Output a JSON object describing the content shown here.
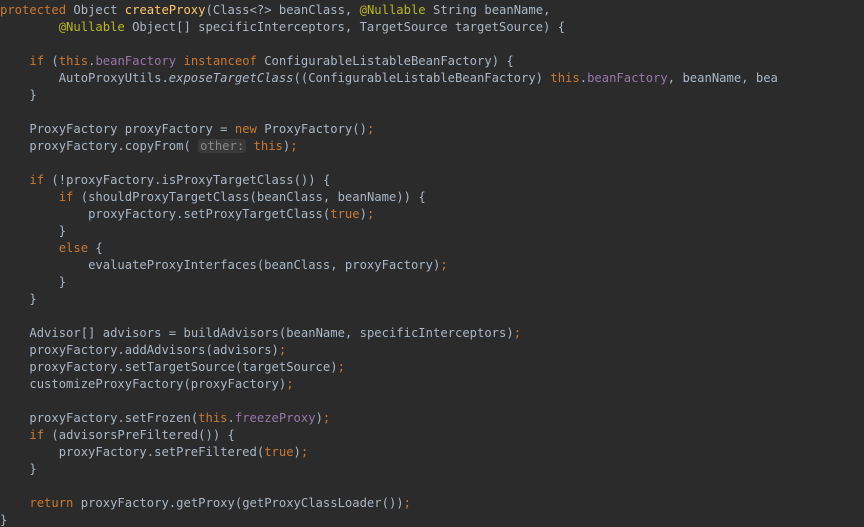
{
  "t": {
    "protected": "protected",
    "Object": "Object",
    "createProxy": "createProxy",
    "open_paren": "(",
    "close_paren": ")",
    "Class_wild": "Class<?>",
    "beanClass": "beanClass",
    "comma": ",",
    "Nullable": "@Nullable",
    "String": "String",
    "beanName": "beanName",
    "ObjectArr": "Object[]",
    "specificInterceptors": "specificInterceptors",
    "TargetSource": "TargetSource",
    "targetSource": "targetSource",
    "obrace": "{",
    "cbrace": "}",
    "if": "if",
    "this": "this",
    "dot": ".",
    "beanFactory": "beanFactory",
    "instanceof": "instanceof",
    "ConfigurableListableBeanFactory": "ConfigurableListableBeanFactory",
    "AutoProxyUtils": "AutoProxyUtils",
    "exposeTargetClass": "exposeTargetClass",
    "cast": "((ConfigurableListableBeanFactory)",
    "bea": "bea",
    "ProxyFactory": "ProxyFactory",
    "proxyFactory": "proxyFactory",
    "eq": "=",
    "new": "new",
    "emptyArgs": "()",
    "semi": ";",
    "copyFrom": "copyFrom",
    "hint_other": "other:",
    "bang": "!",
    "isProxyTargetClass": "isProxyTargetClass",
    "shouldProxyTargetClass": "shouldProxyTargetClass",
    "setProxyTargetClass": "setProxyTargetClass",
    "true": "true",
    "else": "else",
    "evaluateProxyInterfaces": "evaluateProxyInterfaces",
    "AdvisorArr": "Advisor[]",
    "advisors": "advisors",
    "buildAdvisors": "buildAdvisors",
    "addAdvisors": "addAdvisors",
    "setTargetSource": "setTargetSource",
    "customizeProxyFactory": "customizeProxyFactory",
    "setFrozen": "setFrozen",
    "freezeProxy": "freezeProxy",
    "advisorsPreFiltered": "advisorsPreFiltered",
    "setPreFiltered": "setPreFiltered",
    "return": "return",
    "getProxy": "getProxy",
    "getProxyClassLoader": "getProxyClassLoader"
  }
}
